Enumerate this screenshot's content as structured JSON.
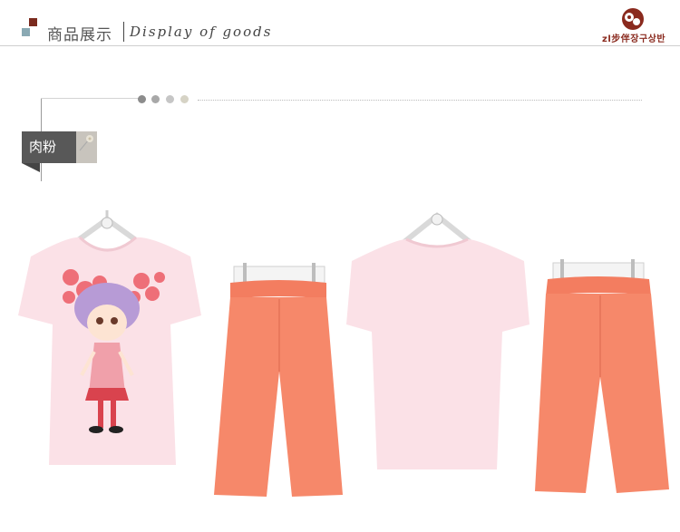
{
  "header": {
    "title_cn": "商品展示",
    "title_en": "Display  of  goods"
  },
  "brand": {
    "text": "zl步伴장구상반",
    "color": "#8a2a1e"
  },
  "section": {
    "color_tag": "肉粉"
  },
  "colors": {
    "shirt": "#fbe1e7",
    "pants": "#f6886a",
    "tag_dark": "#585858",
    "tag_light": "#c8c4bd",
    "dots": [
      "#8c8c8c",
      "#a8a8a8",
      "#c6c6c6",
      "#d6d3c5"
    ]
  },
  "products": [
    {
      "name": "front-tshirt",
      "description": "pink t-shirt with printed girl and roses"
    },
    {
      "name": "front-pants",
      "description": "coral capri pants"
    },
    {
      "name": "back-tshirt",
      "description": "plain pink t-shirt back"
    },
    {
      "name": "back-pants",
      "description": "coral capri pants back"
    }
  ]
}
